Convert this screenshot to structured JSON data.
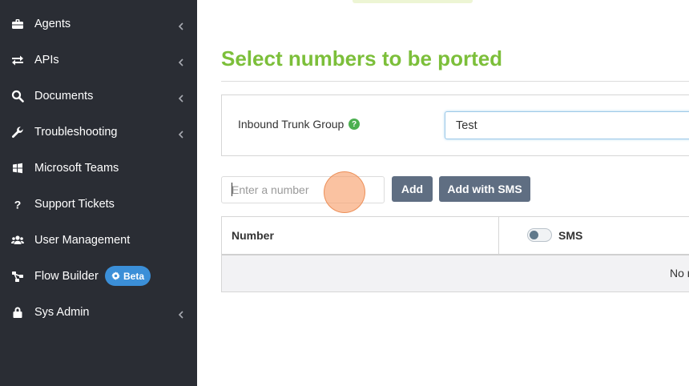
{
  "sidebar": {
    "items": [
      {
        "label": "Agents",
        "icon": "briefcase-icon",
        "chevron": true
      },
      {
        "label": "APIs",
        "icon": "exchange-icon",
        "chevron": true
      },
      {
        "label": "Documents",
        "icon": "search-icon",
        "chevron": true
      },
      {
        "label": "Troubleshooting",
        "icon": "wrench-icon",
        "chevron": true
      },
      {
        "label": "Microsoft Teams",
        "icon": "windows-icon",
        "chevron": false
      },
      {
        "label": "Support Tickets",
        "icon": "question-icon",
        "chevron": false
      },
      {
        "label": "User Management",
        "icon": "users-icon",
        "chevron": false
      },
      {
        "label": "Flow Builder",
        "icon": "sitemap-icon",
        "chevron": false,
        "badge": "Beta"
      },
      {
        "label": "Sys Admin",
        "icon": "lock-icon",
        "chevron": true
      }
    ]
  },
  "main": {
    "title": "Select numbers to be ported",
    "trunk_label": "Inbound Trunk Group",
    "trunk_help": "?",
    "trunk_value": "Test",
    "number_placeholder": "Enter a number",
    "add_label": "Add",
    "add_sms_label": "Add with SMS",
    "table": {
      "col_number": "Number",
      "col_sms": "SMS",
      "empty_text": "No r"
    }
  },
  "colors": {
    "title": "#7cbf3a",
    "sidebar_bg": "#2a2d34",
    "button_bg": "#5f6e82",
    "beta_bg": "#3b8fd8",
    "help_bg": "#4caf50"
  }
}
